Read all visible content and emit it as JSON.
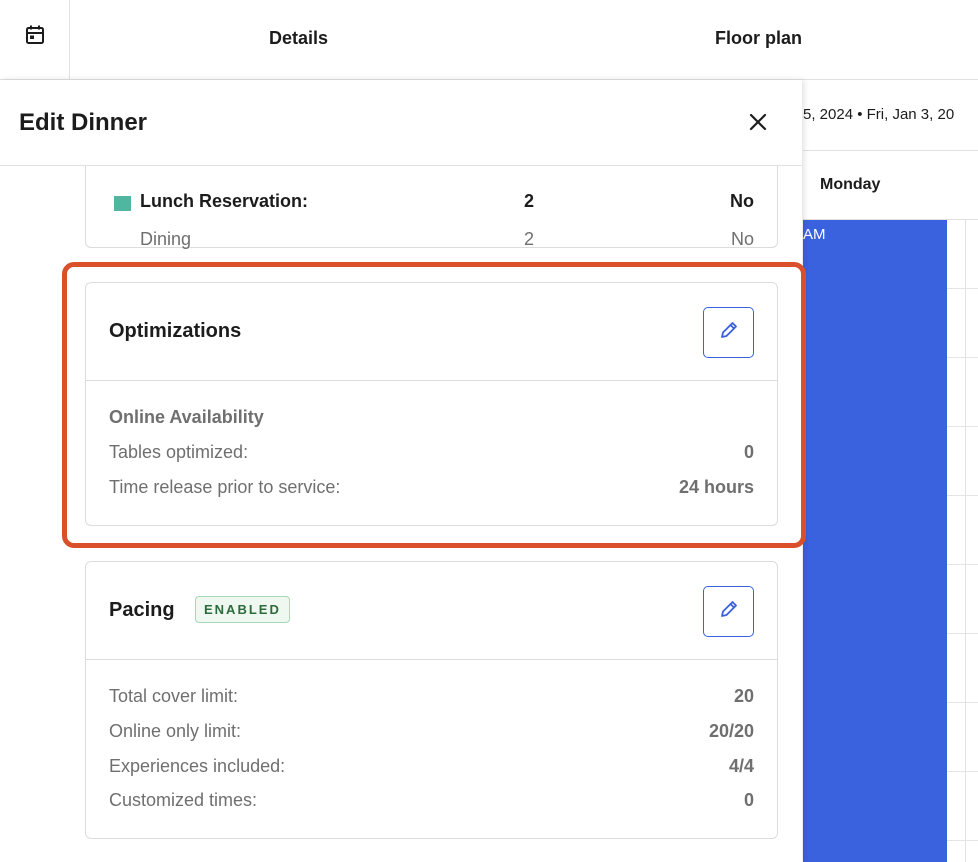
{
  "nav": {
    "calendar_icon": "calendar-icon",
    "tabs": [
      "Details",
      "Floor plan"
    ]
  },
  "background": {
    "date_range": "5, 2024 • Fri, Jan 3, 20",
    "weekday": "Monday",
    "event_label": "AM",
    "event_color": "#3a62de"
  },
  "drawer": {
    "title": "Edit Dinner",
    "close_icon": "close-icon"
  },
  "reservation": {
    "rows": [
      {
        "label": "Lunch Reservation:",
        "count": "2",
        "flag": "No",
        "swatch": "#4fb7a0"
      },
      {
        "label": "Dining",
        "count": "2",
        "flag": "No"
      }
    ]
  },
  "optimizations": {
    "title": "Optimizations",
    "section": "Online Availability",
    "rows": [
      {
        "label": "Tables optimized:",
        "value": "0"
      },
      {
        "label": "Time release prior to service:",
        "value": "24 hours"
      }
    ],
    "highlight_color": "#d9502a"
  },
  "pacing": {
    "title": "Pacing",
    "badge": "ENABLED",
    "rows": [
      {
        "label": "Total cover limit:",
        "value": "20"
      },
      {
        "label": "Online only limit:",
        "value": "20/20"
      },
      {
        "label": "Experiences included:",
        "value": "4/4"
      },
      {
        "label": "Customized times:",
        "value": "0"
      }
    ]
  },
  "colors": {
    "accent": "#3a62de",
    "border": "#dcdcdc",
    "enabled_text": "#2e6b3c"
  }
}
